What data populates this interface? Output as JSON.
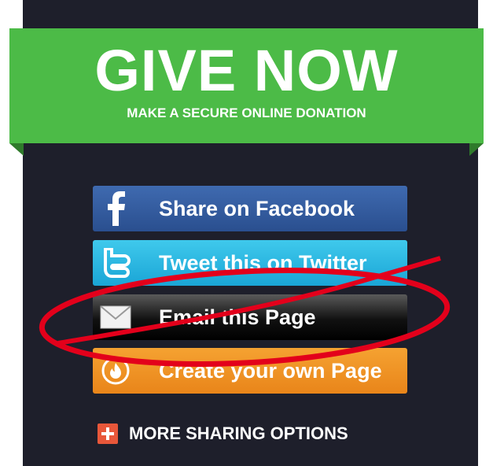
{
  "banner": {
    "title": "GIVE NOW",
    "subtitle": "MAKE A SECURE ONLINE DONATION"
  },
  "share_buttons": [
    {
      "label": "Share on Facebook",
      "icon": "facebook-icon",
      "color": "#3b5998"
    },
    {
      "label": "Tweet this on Twitter",
      "icon": "twitter-icon",
      "color": "#29b7e4"
    },
    {
      "label": "Email this Page",
      "icon": "envelope-icon",
      "color": "#000000"
    },
    {
      "label": "Create your own Page",
      "icon": "flame-icon",
      "color": "#f0921f"
    }
  ],
  "more": {
    "label": "MORE SHARING OPTIONS",
    "icon": "plus-icon"
  },
  "annotation": {
    "color": "#e3001b"
  }
}
